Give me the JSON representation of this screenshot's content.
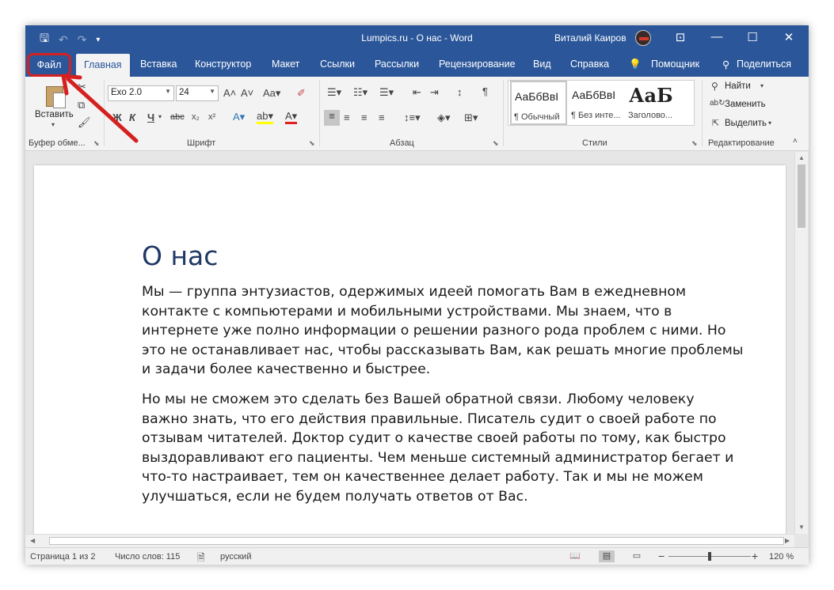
{
  "titlebar": {
    "title": "Lumpics.ru - О нас  -  Word",
    "user_name": "Виталий Каиров",
    "undo_icon": "undo-icon",
    "redo_icon": "redo-icon"
  },
  "tabs": {
    "file": "Файл",
    "home": "Главная",
    "insert": "Вставка",
    "design": "Конструктор",
    "layout": "Макет",
    "references": "Ссылки",
    "mailings": "Рассылки",
    "review": "Рецензирование",
    "view": "Вид",
    "help": "Справка",
    "tell_me": "Помощник",
    "share": "Поделиться"
  },
  "ribbon": {
    "clipboard": {
      "paste_label": "Вставить",
      "group_label": "Буфер обме..."
    },
    "font": {
      "font_name": "Exo 2.0",
      "font_size": "24",
      "bold": "Ж",
      "italic": "К",
      "underline": "Ч",
      "strikethrough": "abc",
      "subscript": "x₂",
      "superscript": "x²",
      "case": "Aa",
      "grow": "A^",
      "shrink": "Aˇ",
      "group_label": "Шрифт"
    },
    "paragraph": {
      "group_label": "Абзац"
    },
    "styles": {
      "items": [
        {
          "sample": "АаБбВвІ",
          "name": "¶ Обычный"
        },
        {
          "sample": "АаБбВвІ",
          "name": "¶ Без инте..."
        },
        {
          "sample": "АаБ",
          "name": "Заголово..."
        }
      ],
      "group_label": "Стили"
    },
    "editing": {
      "find": "Найти",
      "replace": "Заменить",
      "select": "Выделить",
      "group_label": "Редактирование"
    }
  },
  "document": {
    "heading": "О нас",
    "paragraph1": [
      "Мы — группа энтузиастов, одержимых идеей помогать Вам в ежедневном",
      "контакте с компьютерами и мобильными устройствами. Мы знаем, что в",
      "интернете уже полно информации о решении разного рода проблем с ними. Но",
      "это не останавливает нас, чтобы рассказывать Вам, как решать многие проблемы",
      "и задачи более качественно и быстрее."
    ],
    "paragraph2": [
      "Но мы не сможем это сделать без Вашей обратной связи. Любому человеку",
      "важно знать, что его действия правильные. Писатель судит о своей работе по",
      "отзывам читателей. Доктор судит о качестве своей работы по тому, как быстро",
      "выздоравливают его пациенты. Чем меньше системный администратор бегает и",
      "что-то настраивает, тем он качественнее делает работу. Так и мы не можем",
      "улучшаться, если не будем получать ответов от Вас."
    ]
  },
  "statusbar": {
    "page": "Страница 1 из 2",
    "words": "Число слов: 115",
    "language": "русский",
    "zoom": "120 %",
    "zoom_minus": "−",
    "zoom_plus": "+"
  },
  "colors": {
    "word_blue": "#2b579a",
    "heading_blue": "#1f3864",
    "annotation_red": "#d52020"
  }
}
